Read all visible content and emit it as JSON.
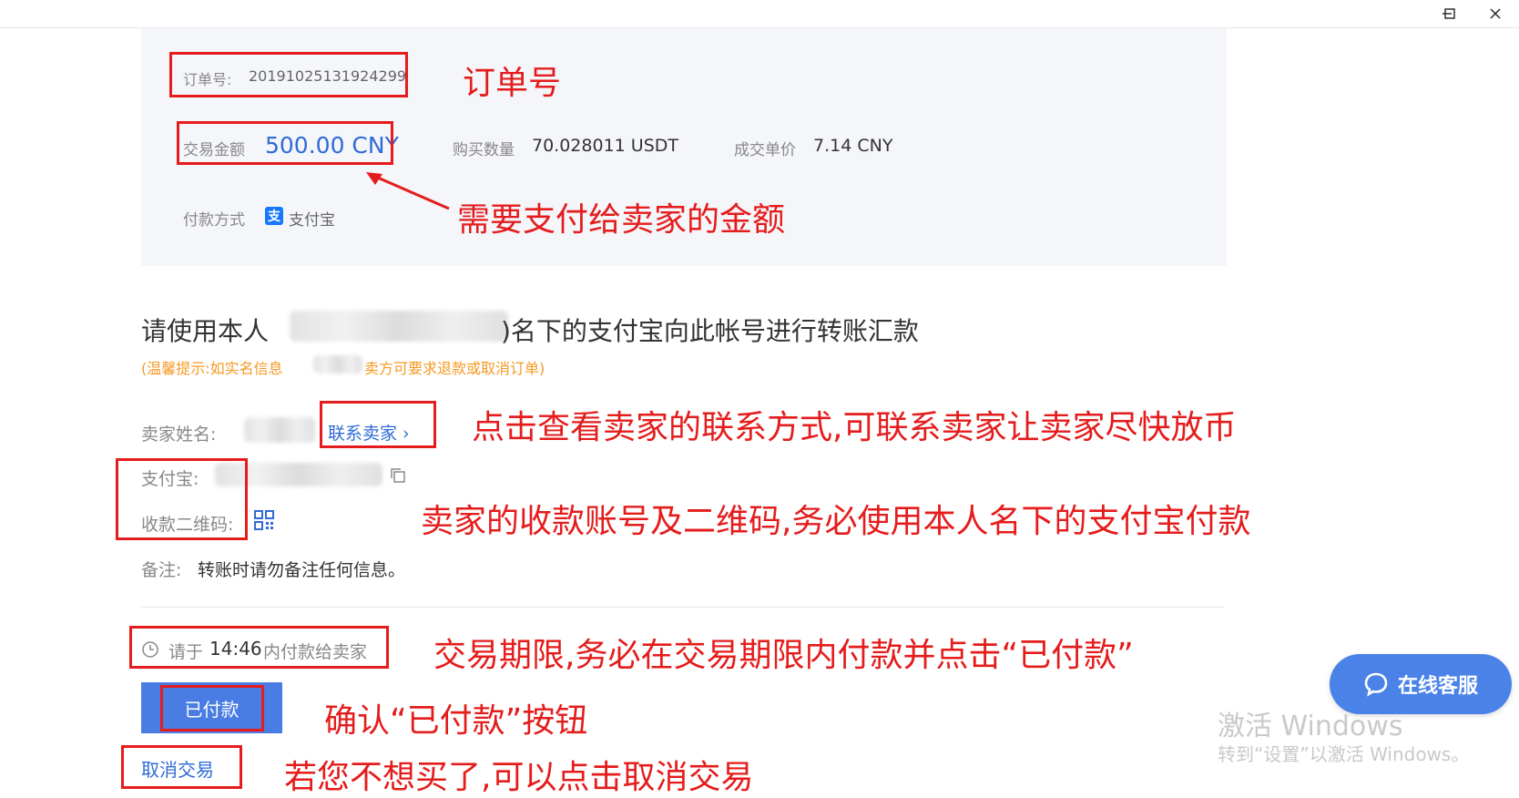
{
  "window": {
    "controls": [
      "minimize",
      "maximize",
      "close"
    ]
  },
  "order": {
    "order_no_label": "订单号:",
    "order_no": "20191025131924299",
    "amount_label": "交易金额",
    "amount": "500.00 CNY",
    "qty_label": "购买数量",
    "qty": "70.028011 USDT",
    "price_label": "成交单价",
    "price": "7.14 CNY",
    "pay_method_label": "付款方式",
    "pay_method": "支付宝",
    "pay_icon_char": "支"
  },
  "instructions": {
    "heading_prefix": "请使用本人",
    "heading_suffix": ")名下的支付宝向此帐号进行转账汇款",
    "tip_prefix": "(温馨提示:如实名信息",
    "tip_suffix": "卖方可要求退款或取消订单)"
  },
  "seller": {
    "name_label": "卖家姓名:",
    "contact_link": "联系卖家",
    "alipay_label": "支付宝:",
    "qrcode_label": "收款二维码:",
    "remark_label": "备注:",
    "remark_value": "转账时请勿备注任何信息。"
  },
  "deadline": {
    "prefix": "请于",
    "time": "14:46",
    "suffix": "内付款给卖家"
  },
  "actions": {
    "paid_button": "已付款",
    "cancel_link": "取消交易"
  },
  "support": {
    "label": "在线客服"
  },
  "watermark": {
    "line1": "激活 Windows",
    "line2": "转到“设置”以激活 Windows。"
  },
  "annotations": {
    "order_no": "订单号",
    "amount": "需要支付给卖家的金额",
    "contact": "点击查看卖家的联系方式,可联系卖家让卖家尽快放币",
    "account": "卖家的收款账号及二维码,务必使用本人名下的支付宝付款",
    "deadline": "交易期限,务必在交易期限内付款并点击“已付款”",
    "paid": "确认“已付款”按钮",
    "cancel": "若您不想买了,可以点击取消交易"
  },
  "colors": {
    "accent": "#2f6bd6",
    "button": "#4a7de3",
    "annotation": "#e51c1c",
    "tip": "#f59a23"
  }
}
